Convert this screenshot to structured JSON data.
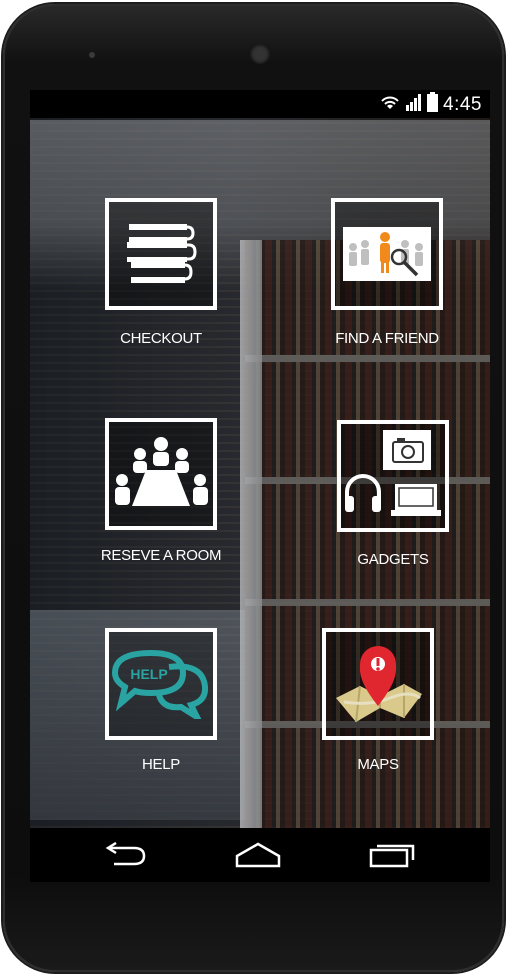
{
  "status_bar": {
    "time": "4:45",
    "icons": [
      "wifi-icon",
      "signal-icon",
      "battery-icon"
    ]
  },
  "tiles": [
    {
      "id": "checkout",
      "label": "CHECKOUT",
      "icon": "books-icon"
    },
    {
      "id": "find-a-friend",
      "label": "FIND A FRIEND",
      "icon": "people-search-icon"
    },
    {
      "id": "reserve-a-room",
      "label": "RESEVE A ROOM",
      "icon": "meeting-room-icon"
    },
    {
      "id": "gadgets",
      "label": "GADGETS",
      "icon": "gadgets-icon"
    },
    {
      "id": "help",
      "label": "HELP",
      "icon": "help-bubble-icon",
      "icon_text": "HELP"
    },
    {
      "id": "maps",
      "label": "MAPS",
      "icon": "map-pin-icon"
    }
  ],
  "nav_bar": {
    "buttons": [
      "back-icon",
      "home-icon",
      "recents-icon"
    ]
  },
  "colors": {
    "tile_border": "#ffffff",
    "help_teal": "#2aa3a3",
    "map_pin_red": "#e0262e"
  }
}
